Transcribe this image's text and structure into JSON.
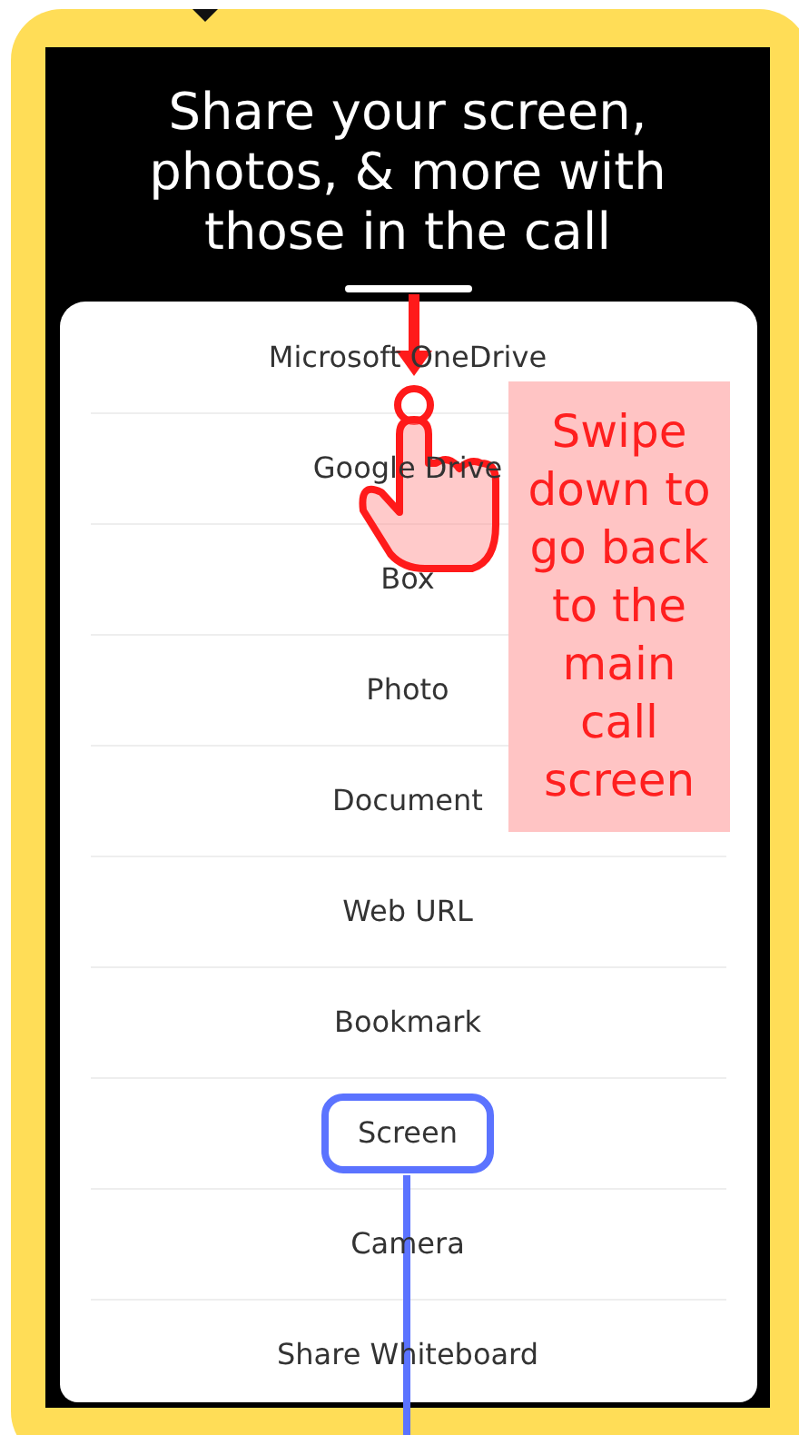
{
  "header": {
    "title": "Share your screen, photos, & more with those in the call"
  },
  "share_options": [
    {
      "label": "Microsoft OneDrive",
      "highlighted": false
    },
    {
      "label": "Google Drive",
      "highlighted": false
    },
    {
      "label": "Box",
      "highlighted": false
    },
    {
      "label": "Photo",
      "highlighted": false
    },
    {
      "label": "Document",
      "highlighted": false
    },
    {
      "label": "Web URL",
      "highlighted": false
    },
    {
      "label": "Bookmark",
      "highlighted": false
    },
    {
      "label": "Screen",
      "highlighted": true
    },
    {
      "label": "Camera",
      "highlighted": false
    },
    {
      "label": "Share Whiteboard",
      "highlighted": false
    }
  ],
  "callout": {
    "text": "Swipe down to go back to the main call screen"
  }
}
